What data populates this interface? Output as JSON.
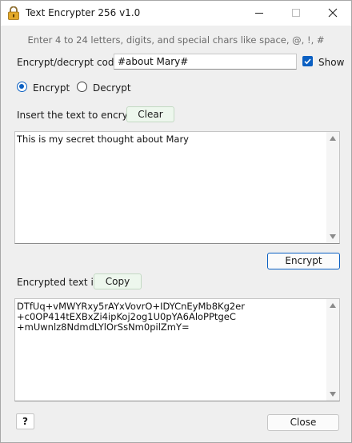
{
  "window": {
    "title": "Text Encrypter 256 v1.0",
    "icons": [
      "lock-icon",
      "minimize-icon",
      "maximize-icon",
      "close-icon"
    ]
  },
  "hint": "Enter 4 to 24 letters, digits, and special chars like space, @, !,  #",
  "code": {
    "label": "Encrypt/decrypt code:",
    "value": "#about Mary#",
    "show_label": "Show",
    "show_checked": true
  },
  "mode": {
    "encrypt_label": "Encrypt",
    "decrypt_label": "Decrypt",
    "selected": "Encrypt"
  },
  "input_section": {
    "label": "Insert the text to encrypt:",
    "clear_label": "Clear",
    "text": "This is my secret thought about Mary"
  },
  "encrypt_button": "Encrypt",
  "output_section": {
    "label": "Encrypted text is:",
    "copy_label": "Copy",
    "text": "DTfUq+vMWYRxy5rAYxVovrO+IDYCnEyMb8Kg2er\n+c0OP414tEXBxZi4ipKoj2og1U0pYA6AloPPtgeC\n+mUwnlz8NdmdLYlOrSsNm0pilZmY="
  },
  "footer": {
    "help_label": "?",
    "close_label": "Close"
  },
  "colors": {
    "accent": "#0a5fc2",
    "window_bg": "#efefef",
    "action_button_bg": "#edf7ed"
  }
}
